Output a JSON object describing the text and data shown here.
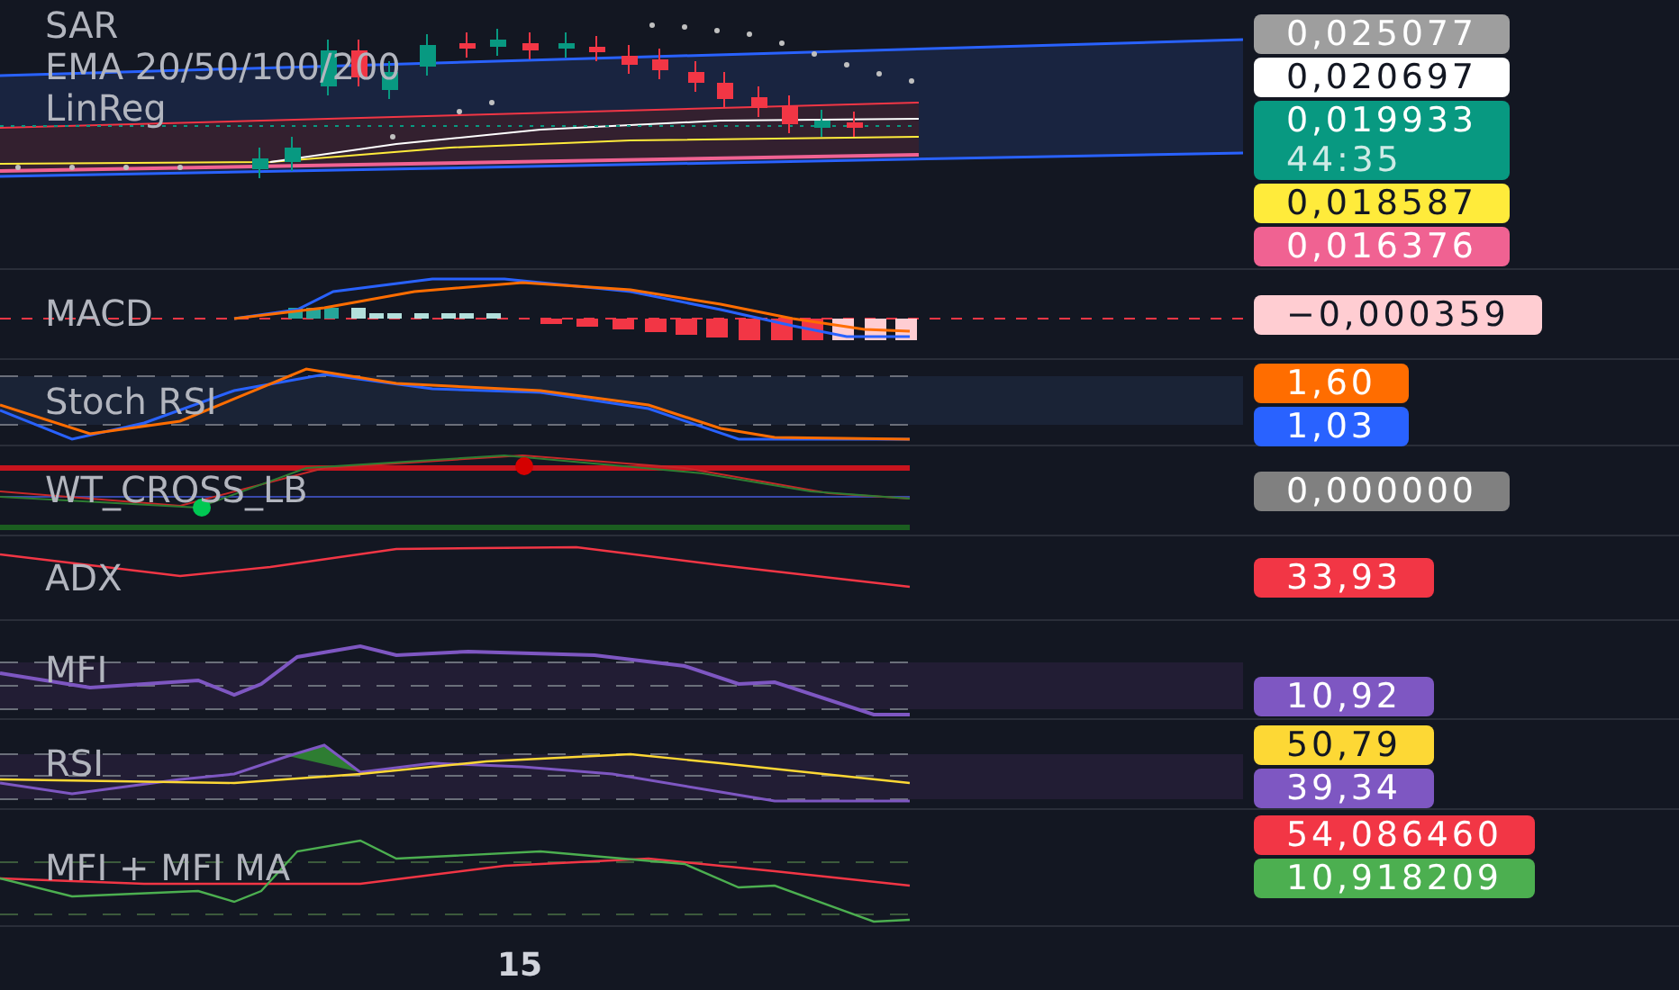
{
  "panes": [
    {
      "kind": "price",
      "legend": [
        "SAR",
        "EMA 20/50/100/200",
        "LinReg"
      ],
      "badges": [
        {
          "text": "0,025077",
          "color": "#9e9e9e"
        },
        {
          "text": "0,020697",
          "color": "#ffffff"
        },
        {
          "text": "0,019933",
          "countdown": "44:35",
          "color": "#089981"
        },
        {
          "text": "0,018587",
          "color": "#ffeb3b"
        },
        {
          "text": "0,016376",
          "color": "#f06292"
        }
      ]
    },
    {
      "kind": "macd",
      "legend": [
        "MACD"
      ],
      "badges": [
        {
          "text": "−0,000359",
          "color": "#ffcdd2"
        }
      ]
    },
    {
      "kind": "stoch",
      "legend": [
        "Stoch RSI"
      ],
      "badges": [
        {
          "text": "1,60",
          "color": "#ff6d00"
        },
        {
          "text": "1,03",
          "color": "#2962ff"
        }
      ]
    },
    {
      "kind": "wt",
      "legend": [
        "WT_CROSS_LB"
      ],
      "badges": [
        {
          "text": "0,000000",
          "color": "#808080"
        }
      ]
    },
    {
      "kind": "adx",
      "legend": [
        "ADX"
      ],
      "badges": [
        {
          "text": "33,93",
          "color": "#f23645"
        }
      ]
    },
    {
      "kind": "mfi",
      "legend": [
        "MFI"
      ],
      "badges": [
        {
          "text": "10,92",
          "color": "#7e57c2"
        }
      ]
    },
    {
      "kind": "rsi",
      "legend": [
        "RSI"
      ],
      "badges": [
        {
          "text": "50,79",
          "color": "#fdd835"
        },
        {
          "text": "39,34",
          "color": "#7e57c2"
        }
      ]
    },
    {
      "kind": "mfima",
      "legend": [
        "MFI + MFI MA"
      ],
      "badges": [
        {
          "text": "54,086460",
          "color": "#f23645"
        },
        {
          "text": "10,918209",
          "color": "#4caf50"
        }
      ]
    }
  ],
  "time_axis": {
    "label": "15"
  }
}
